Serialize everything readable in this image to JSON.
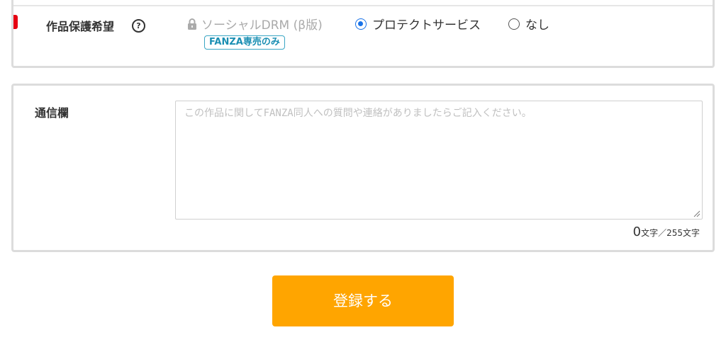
{
  "protection": {
    "label": "作品保護希望",
    "help_icon": "question-circle-icon",
    "options": [
      {
        "label": "ソーシャルDRM (β版)",
        "disabled": true,
        "icon": "lock-icon"
      },
      {
        "label": "プロテクトサービス",
        "selected": true
      },
      {
        "label": "なし",
        "selected": false
      }
    ],
    "badge": "FANZA専売のみ",
    "required_mark_color": "#e60012"
  },
  "message": {
    "label": "通信欄",
    "placeholder": "この作品に関してFANZA同人への質問や連絡がありましたらご記入ください。",
    "value": "",
    "count": "0",
    "count_suffix": "文字／255文字"
  },
  "submit": {
    "label": "登録する",
    "color": "#ffa500"
  }
}
